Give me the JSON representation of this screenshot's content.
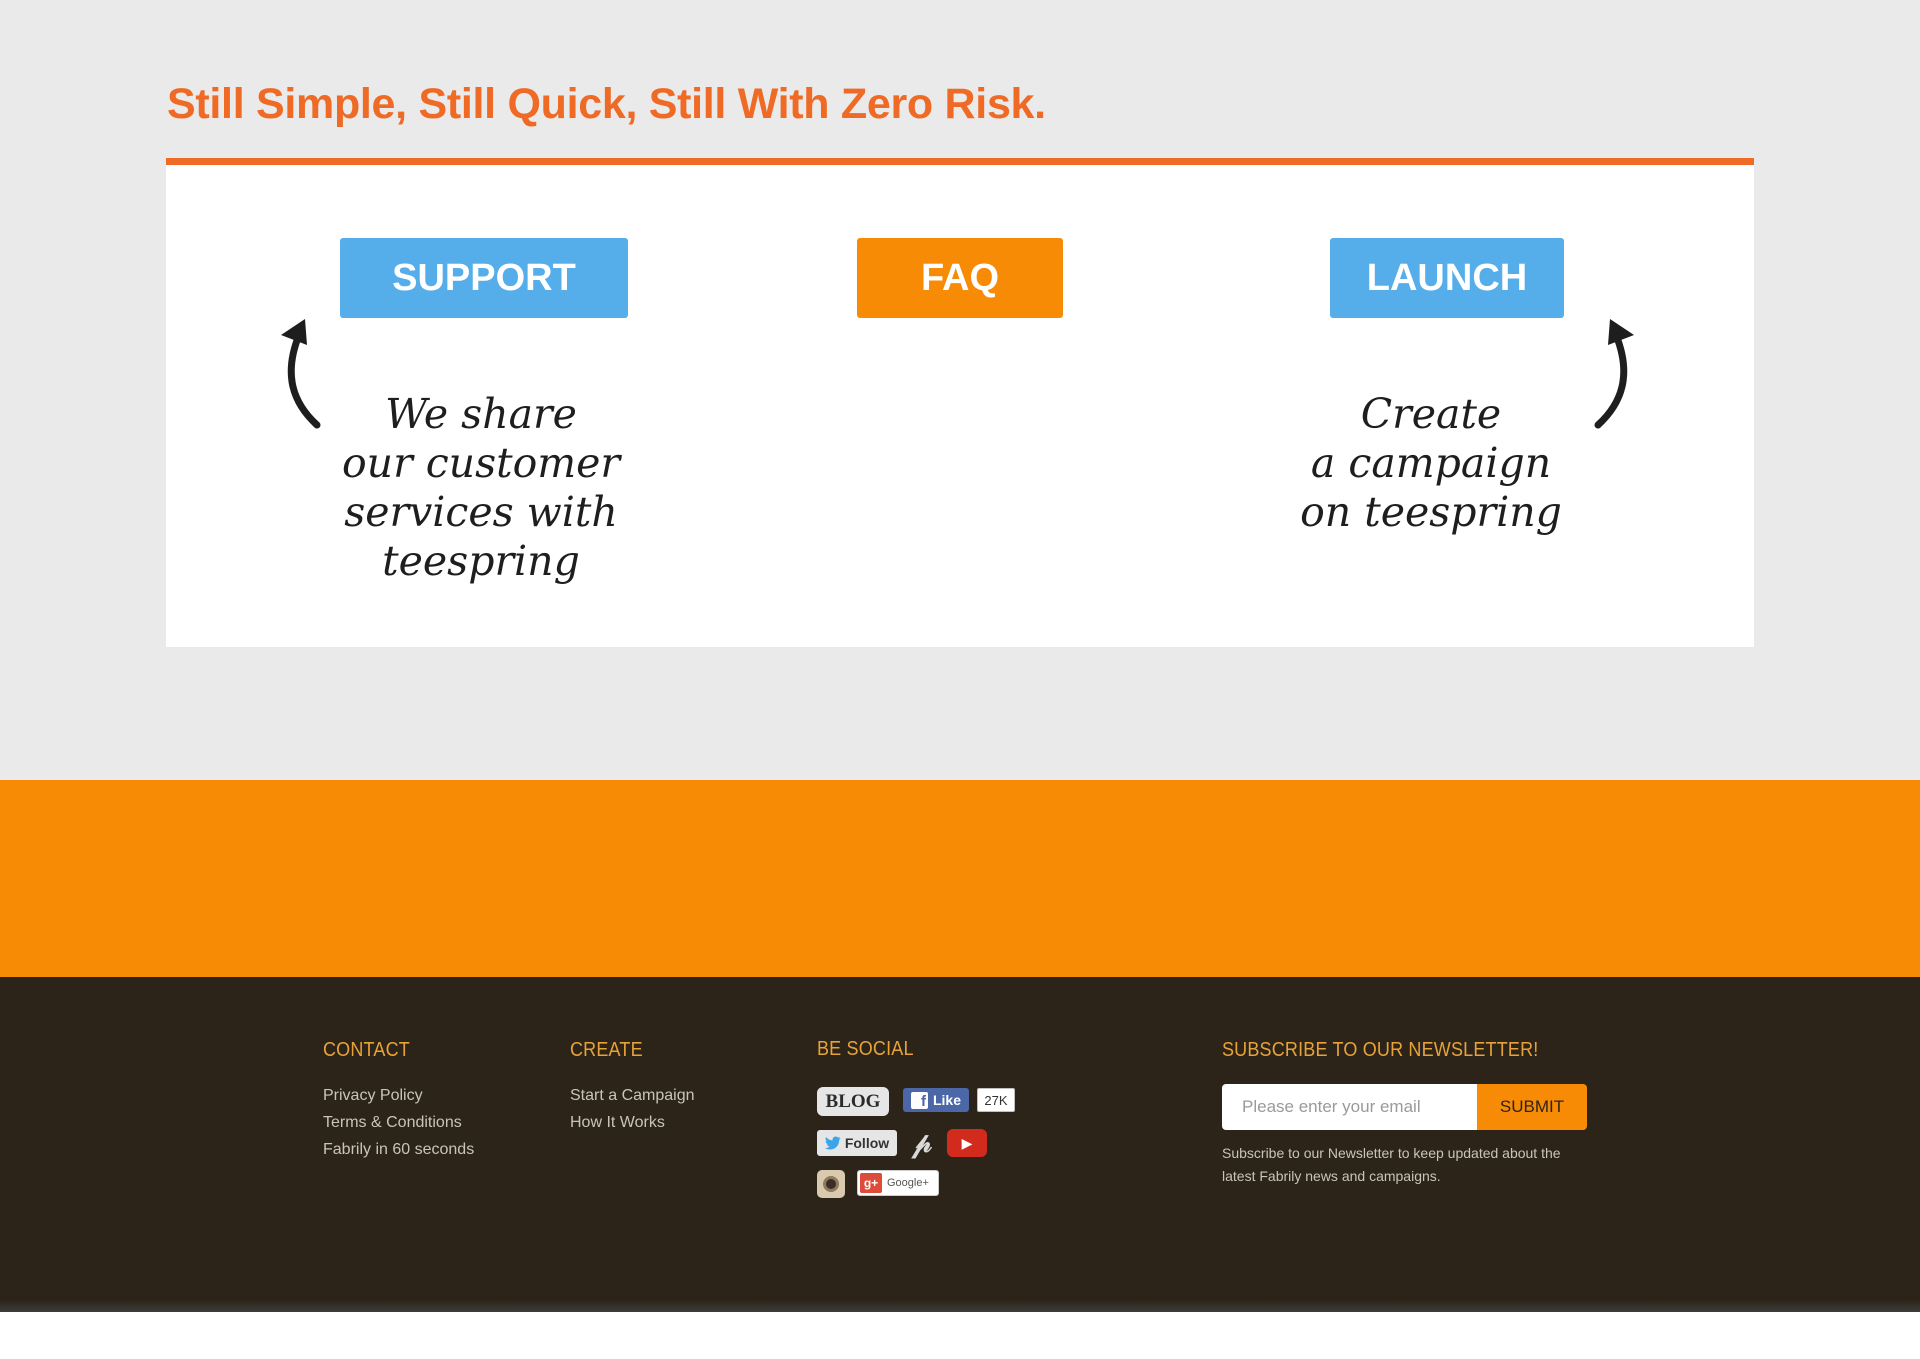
{
  "section": {
    "headline": "Still Simple, Still Quick, Still With Zero Risk."
  },
  "card": {
    "buttons": {
      "support": "SUPPORT",
      "faq": "FAQ",
      "launch": "LAUNCH"
    },
    "notes": {
      "left": [
        "We share",
        "our customer",
        "services with",
        "teespring"
      ],
      "right": [
        "Create",
        "a campaign",
        "on teespring"
      ]
    }
  },
  "footer": {
    "contact": {
      "title": "CONTACT",
      "links": [
        "Privacy Policy",
        "Terms & Conditions",
        "Fabrily in 60 seconds"
      ]
    },
    "create": {
      "title": "CREATE",
      "links": [
        "Start a Campaign",
        "How It Works"
      ]
    },
    "social": {
      "title": "BE SOCIAL",
      "blog": "BLOG",
      "facebook_like": "Like",
      "facebook_count": "27K",
      "twitter_follow": "Follow",
      "google_plus": "Google+",
      "icons": [
        "blog-icon",
        "facebook-icon",
        "twitter-icon",
        "pinterest-icon",
        "youtube-icon",
        "instagram-icon",
        "google-plus-icon"
      ]
    },
    "newsletter": {
      "title": "SUBSCRIBE TO OUR NEWSLETTER!",
      "placeholder": "Please enter your email",
      "submit": "SUBMIT",
      "note": [
        "Subscribe to our Newsletter to keep updated about the",
        "latest Fabrily news and campaigns."
      ]
    }
  },
  "colors": {
    "accent_orange": "#f78b06",
    "headline_orange": "#ef6a25",
    "button_blue": "#55aeea",
    "footer_bg": "#2c2418",
    "footer_title": "#e8a23a"
  }
}
